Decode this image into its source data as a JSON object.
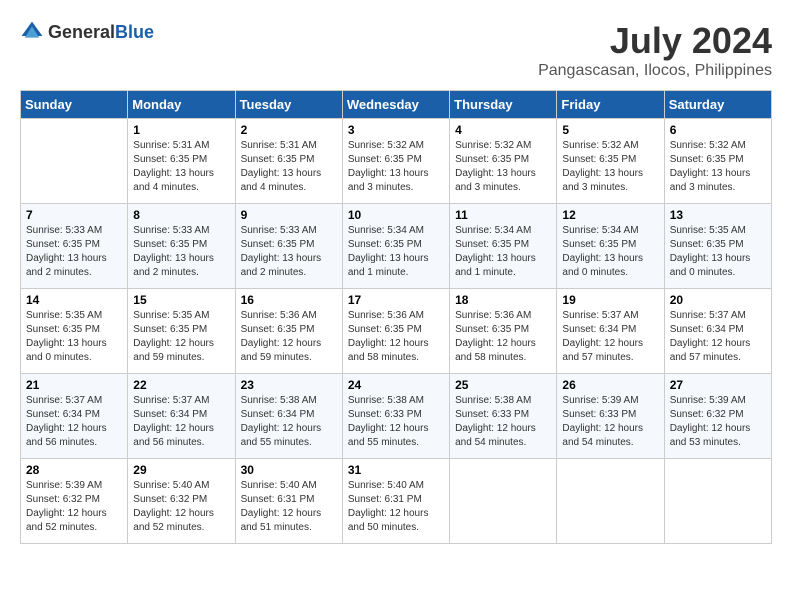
{
  "logo": {
    "general": "General",
    "blue": "Blue"
  },
  "title": {
    "month_year": "July 2024",
    "location": "Pangascasan, Ilocos, Philippines"
  },
  "weekdays": [
    "Sunday",
    "Monday",
    "Tuesday",
    "Wednesday",
    "Thursday",
    "Friday",
    "Saturday"
  ],
  "weeks": [
    [
      {
        "day": "",
        "info": ""
      },
      {
        "day": "1",
        "info": "Sunrise: 5:31 AM\nSunset: 6:35 PM\nDaylight: 13 hours\nand 4 minutes."
      },
      {
        "day": "2",
        "info": "Sunrise: 5:31 AM\nSunset: 6:35 PM\nDaylight: 13 hours\nand 4 minutes."
      },
      {
        "day": "3",
        "info": "Sunrise: 5:32 AM\nSunset: 6:35 PM\nDaylight: 13 hours\nand 3 minutes."
      },
      {
        "day": "4",
        "info": "Sunrise: 5:32 AM\nSunset: 6:35 PM\nDaylight: 13 hours\nand 3 minutes."
      },
      {
        "day": "5",
        "info": "Sunrise: 5:32 AM\nSunset: 6:35 PM\nDaylight: 13 hours\nand 3 minutes."
      },
      {
        "day": "6",
        "info": "Sunrise: 5:32 AM\nSunset: 6:35 PM\nDaylight: 13 hours\nand 3 minutes."
      }
    ],
    [
      {
        "day": "7",
        "info": "Sunrise: 5:33 AM\nSunset: 6:35 PM\nDaylight: 13 hours\nand 2 minutes."
      },
      {
        "day": "8",
        "info": "Sunrise: 5:33 AM\nSunset: 6:35 PM\nDaylight: 13 hours\nand 2 minutes."
      },
      {
        "day": "9",
        "info": "Sunrise: 5:33 AM\nSunset: 6:35 PM\nDaylight: 13 hours\nand 2 minutes."
      },
      {
        "day": "10",
        "info": "Sunrise: 5:34 AM\nSunset: 6:35 PM\nDaylight: 13 hours\nand 1 minute."
      },
      {
        "day": "11",
        "info": "Sunrise: 5:34 AM\nSunset: 6:35 PM\nDaylight: 13 hours\nand 1 minute."
      },
      {
        "day": "12",
        "info": "Sunrise: 5:34 AM\nSunset: 6:35 PM\nDaylight: 13 hours\nand 0 minutes."
      },
      {
        "day": "13",
        "info": "Sunrise: 5:35 AM\nSunset: 6:35 PM\nDaylight: 13 hours\nand 0 minutes."
      }
    ],
    [
      {
        "day": "14",
        "info": "Sunrise: 5:35 AM\nSunset: 6:35 PM\nDaylight: 13 hours\nand 0 minutes."
      },
      {
        "day": "15",
        "info": "Sunrise: 5:35 AM\nSunset: 6:35 PM\nDaylight: 12 hours\nand 59 minutes."
      },
      {
        "day": "16",
        "info": "Sunrise: 5:36 AM\nSunset: 6:35 PM\nDaylight: 12 hours\nand 59 minutes."
      },
      {
        "day": "17",
        "info": "Sunrise: 5:36 AM\nSunset: 6:35 PM\nDaylight: 12 hours\nand 58 minutes."
      },
      {
        "day": "18",
        "info": "Sunrise: 5:36 AM\nSunset: 6:35 PM\nDaylight: 12 hours\nand 58 minutes."
      },
      {
        "day": "19",
        "info": "Sunrise: 5:37 AM\nSunset: 6:34 PM\nDaylight: 12 hours\nand 57 minutes."
      },
      {
        "day": "20",
        "info": "Sunrise: 5:37 AM\nSunset: 6:34 PM\nDaylight: 12 hours\nand 57 minutes."
      }
    ],
    [
      {
        "day": "21",
        "info": "Sunrise: 5:37 AM\nSunset: 6:34 PM\nDaylight: 12 hours\nand 56 minutes."
      },
      {
        "day": "22",
        "info": "Sunrise: 5:37 AM\nSunset: 6:34 PM\nDaylight: 12 hours\nand 56 minutes."
      },
      {
        "day": "23",
        "info": "Sunrise: 5:38 AM\nSunset: 6:34 PM\nDaylight: 12 hours\nand 55 minutes."
      },
      {
        "day": "24",
        "info": "Sunrise: 5:38 AM\nSunset: 6:33 PM\nDaylight: 12 hours\nand 55 minutes."
      },
      {
        "day": "25",
        "info": "Sunrise: 5:38 AM\nSunset: 6:33 PM\nDaylight: 12 hours\nand 54 minutes."
      },
      {
        "day": "26",
        "info": "Sunrise: 5:39 AM\nSunset: 6:33 PM\nDaylight: 12 hours\nand 54 minutes."
      },
      {
        "day": "27",
        "info": "Sunrise: 5:39 AM\nSunset: 6:32 PM\nDaylight: 12 hours\nand 53 minutes."
      }
    ],
    [
      {
        "day": "28",
        "info": "Sunrise: 5:39 AM\nSunset: 6:32 PM\nDaylight: 12 hours\nand 52 minutes."
      },
      {
        "day": "29",
        "info": "Sunrise: 5:40 AM\nSunset: 6:32 PM\nDaylight: 12 hours\nand 52 minutes."
      },
      {
        "day": "30",
        "info": "Sunrise: 5:40 AM\nSunset: 6:31 PM\nDaylight: 12 hours\nand 51 minutes."
      },
      {
        "day": "31",
        "info": "Sunrise: 5:40 AM\nSunset: 6:31 PM\nDaylight: 12 hours\nand 50 minutes."
      },
      {
        "day": "",
        "info": ""
      },
      {
        "day": "",
        "info": ""
      },
      {
        "day": "",
        "info": ""
      }
    ]
  ]
}
